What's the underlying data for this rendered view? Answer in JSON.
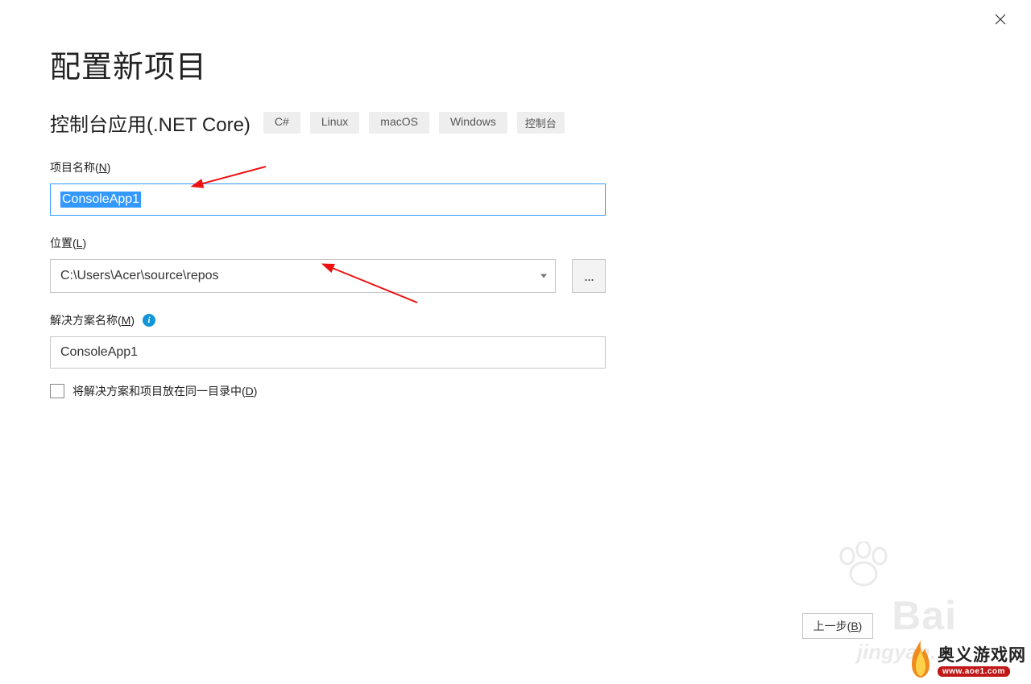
{
  "header": {
    "title": "配置新项目",
    "subtitle": "控制台应用(.NET Core)",
    "tags": [
      "C#",
      "Linux",
      "macOS",
      "Windows",
      "控制台"
    ]
  },
  "form": {
    "project_name": {
      "label_prefix": "项目名称(",
      "mnemonic": "N",
      "label_suffix": ")",
      "value": "ConsoleApp1",
      "selected": true
    },
    "location": {
      "label_prefix": "位置(",
      "mnemonic": "L",
      "label_suffix": ")",
      "value": "C:\\Users\\Acer\\source\\repos",
      "browse_label": "..."
    },
    "solution_name": {
      "label_prefix": "解决方案名称(",
      "mnemonic": "M",
      "label_suffix": ")",
      "value": "ConsoleApp1"
    },
    "same_dir_checkbox": {
      "label_prefix": "将解决方案和项目放在同一目录中(",
      "mnemonic": "D",
      "label_suffix": ")",
      "checked": false
    }
  },
  "footer": {
    "next_button_prefix": "上一步(",
    "next_button_mnemonic": "B",
    "next_button_suffix": ")"
  },
  "watermark": {
    "baidu": "Bai",
    "jingyan": "jingyan.",
    "logo_cn": "奥义游戏网",
    "logo_url": "www.aoe1.com"
  },
  "info_icon_text": "i"
}
